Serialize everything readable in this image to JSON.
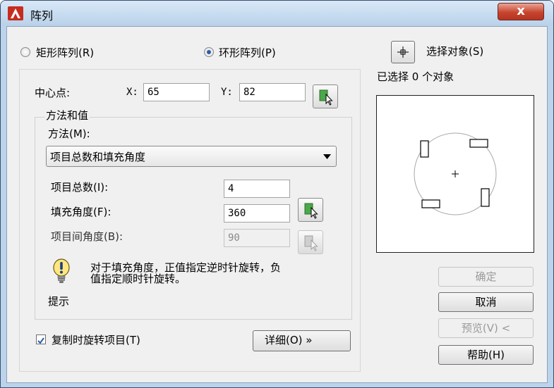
{
  "window": {
    "title": "阵列",
    "close_label": "x"
  },
  "array_type": {
    "rect_label": "矩形阵列(R)",
    "polar_label": "环形阵列(P)",
    "selected": "polar"
  },
  "select_objects": {
    "button_label": "选择对象(S)",
    "status": "已选择 0 个对象"
  },
  "center": {
    "label": "中心点:",
    "x_label": "X:",
    "x_value": "65",
    "y_label": "Y:",
    "y_value": "82"
  },
  "method_group": {
    "title": "方法和值",
    "method_label": "方法(M):",
    "method_value": "项目总数和填充角度",
    "items_label": "项目总数(I):",
    "items_value": "4",
    "fill_label": "填充角度(F):",
    "fill_value": "360",
    "between_label": "项目间角度(B):",
    "between_value": "90"
  },
  "tip": {
    "line1": "对于填充角度，正值指定逆时针旋转，负",
    "line2": "值指定顺时针旋转。",
    "caption": "提示"
  },
  "rotate_items": {
    "label": "复制时旋转项目(T)",
    "checked": true
  },
  "details_button": "详细(O) »",
  "buttons": {
    "ok": "确定",
    "cancel": "取消",
    "preview": "预览(V) <",
    "help": "帮助(H)"
  },
  "colors": {
    "accent": "#2b5da8",
    "window_frame": "#bcd3ec",
    "close": "#c7442e",
    "pick_green": "#2f8a2f"
  }
}
